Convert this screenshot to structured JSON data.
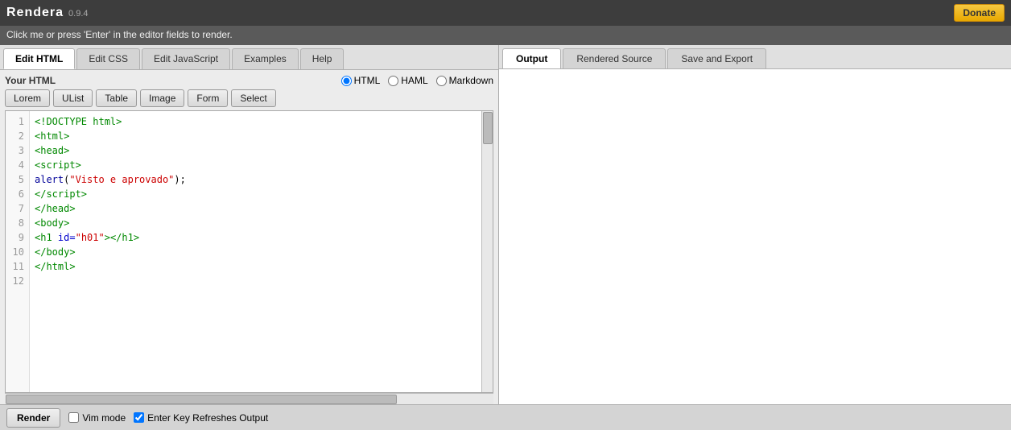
{
  "app": {
    "title": "Rendera",
    "version": "0.9.4",
    "subtitle": "Click me or press 'Enter' in the editor fields to render.",
    "donate_label": "Donate"
  },
  "left": {
    "tabs": [
      {
        "label": "Edit HTML",
        "active": true
      },
      {
        "label": "Edit CSS",
        "active": false
      },
      {
        "label": "Edit JavaScript",
        "active": false
      },
      {
        "label": "Examples",
        "active": false
      },
      {
        "label": "Help",
        "active": false
      }
    ],
    "your_html_label": "Your HTML",
    "formats": [
      {
        "label": "HTML",
        "selected": true
      },
      {
        "label": "HAML",
        "selected": false
      },
      {
        "label": "Markdown",
        "selected": false
      }
    ],
    "snippets": [
      {
        "label": "Lorem"
      },
      {
        "label": "UList"
      },
      {
        "label": "Table"
      },
      {
        "label": "Image"
      },
      {
        "label": "Form"
      },
      {
        "label": "Select"
      }
    ],
    "code_lines": [
      1,
      2,
      3,
      4,
      5,
      6,
      7,
      8,
      9,
      10,
      11,
      12
    ]
  },
  "right": {
    "tabs": [
      {
        "label": "Output",
        "active": true
      },
      {
        "label": "Rendered Source",
        "active": false
      },
      {
        "label": "Save and Export",
        "active": false
      }
    ]
  },
  "bottom": {
    "render_label": "Render",
    "vim_mode_label": "Vim mode",
    "enter_key_label": "Enter Key Refreshes Output"
  },
  "icons": {
    "checkbox_checked": "✓",
    "radio_selected": "●",
    "radio_empty": "○"
  }
}
